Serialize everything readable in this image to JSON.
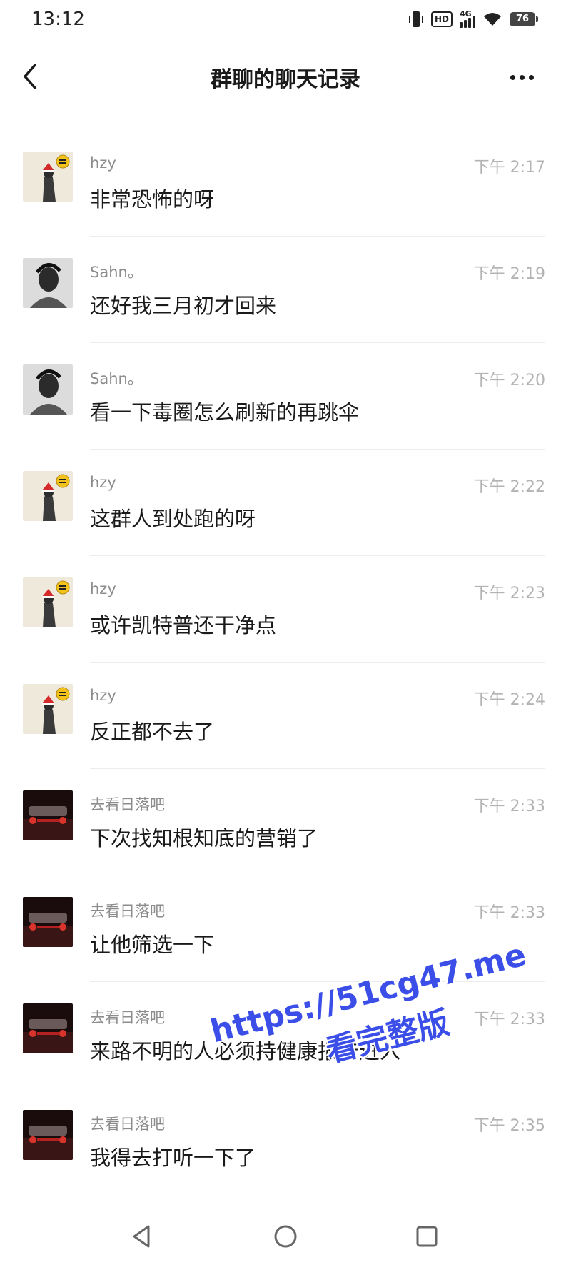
{
  "status_bar": {
    "time": "13:12",
    "network": "4G",
    "hd_label": "HD",
    "battery": "76"
  },
  "header": {
    "title": "群聊的聊天记录"
  },
  "messages": [
    {
      "sender": "hzy",
      "time": "下午 2:17",
      "text": "非常恐怖的呀",
      "avatar": "hzy-avatar"
    },
    {
      "sender": "Sahn。",
      "time": "下午 2:19",
      "text": "还好我三月初才回来",
      "avatar": "sahn-avatar"
    },
    {
      "sender": "Sahn。",
      "time": "下午 2:20",
      "text": "看一下毒圈怎么刷新的再跳伞",
      "avatar": "sahn-avatar"
    },
    {
      "sender": "hzy",
      "time": "下午 2:22",
      "text": "这群人到处跑的呀",
      "avatar": "hzy-avatar"
    },
    {
      "sender": "hzy",
      "time": "下午 2:23",
      "text": "或许凯特普还干净点",
      "avatar": "hzy-avatar"
    },
    {
      "sender": "hzy",
      "time": "下午 2:24",
      "text": "反正都不去了",
      "avatar": "hzy-avatar"
    },
    {
      "sender": "去看日落吧",
      "time": "下午 2:33",
      "text": "下次找知根知底的营销了",
      "avatar": "car-night-avatar"
    },
    {
      "sender": "去看日落吧",
      "time": "下午 2:33",
      "text": "让他筛选一下",
      "avatar": "car-night-avatar"
    },
    {
      "sender": "去看日落吧",
      "time": "下午 2:33",
      "text": "来路不明的人必须持健康报告进入",
      "avatar": "car-night-avatar"
    },
    {
      "sender": "去看日落吧",
      "time": "下午 2:35",
      "text": "我得去打听一下了",
      "avatar": "car-night-avatar"
    }
  ],
  "watermark": {
    "url": "https://51cg47.me",
    "caption": "看完整版"
  },
  "colors": {
    "watermark": "#3b4fe8",
    "time_text": "#b3b3b3",
    "sender_text": "#8c8c8c"
  }
}
